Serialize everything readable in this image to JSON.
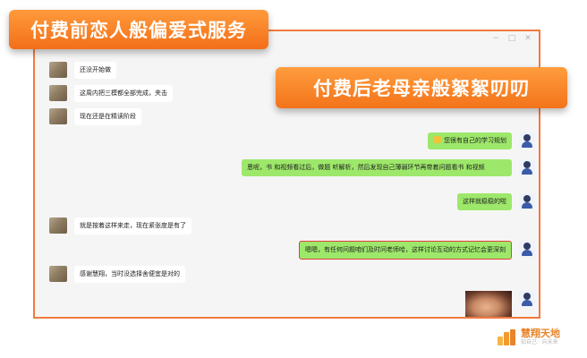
{
  "banners": {
    "top_left": "付费前恋人般偏爱式服务",
    "right": "付费后老母亲般絮絮叨叨"
  },
  "window_controls": [
    "−",
    "□",
    "✕"
  ],
  "messages": [
    {
      "side": "other",
      "text": "还没开始做"
    },
    {
      "side": "other",
      "text": "这周内把三模都全部完成，夹击"
    },
    {
      "side": "other",
      "text": "现在还是在精读阶段"
    },
    {
      "side": "self",
      "text": "您很有自己的学习规划"
    },
    {
      "side": "self",
      "text": "恩呢，书 和视频看过后，做题  听解析，然后发现自己薄弱环节再带着问题看书 和视频"
    },
    {
      "side": "self",
      "text": "这样就稳稳的啦"
    },
    {
      "side": "other",
      "text": "就是按着这样来走，现在紧张度是有了"
    },
    {
      "side": "self",
      "text": "嗯嗯，有任何问题咱们及时问老师哈，这样讨论互动的方式记忆会更深刻",
      "highlighted": true
    },
    {
      "side": "other",
      "text": "感谢慧翔，当时没选择舍便宜是对的"
    }
  ],
  "logo": {
    "name": "慧翔天地",
    "slogan": "知自己 · 向未来"
  },
  "colors": {
    "accent_orange": "#f36f18",
    "self_bubble": "#9de86a",
    "other_bubble": "#ffffff",
    "highlight_border": "#e0403a"
  }
}
